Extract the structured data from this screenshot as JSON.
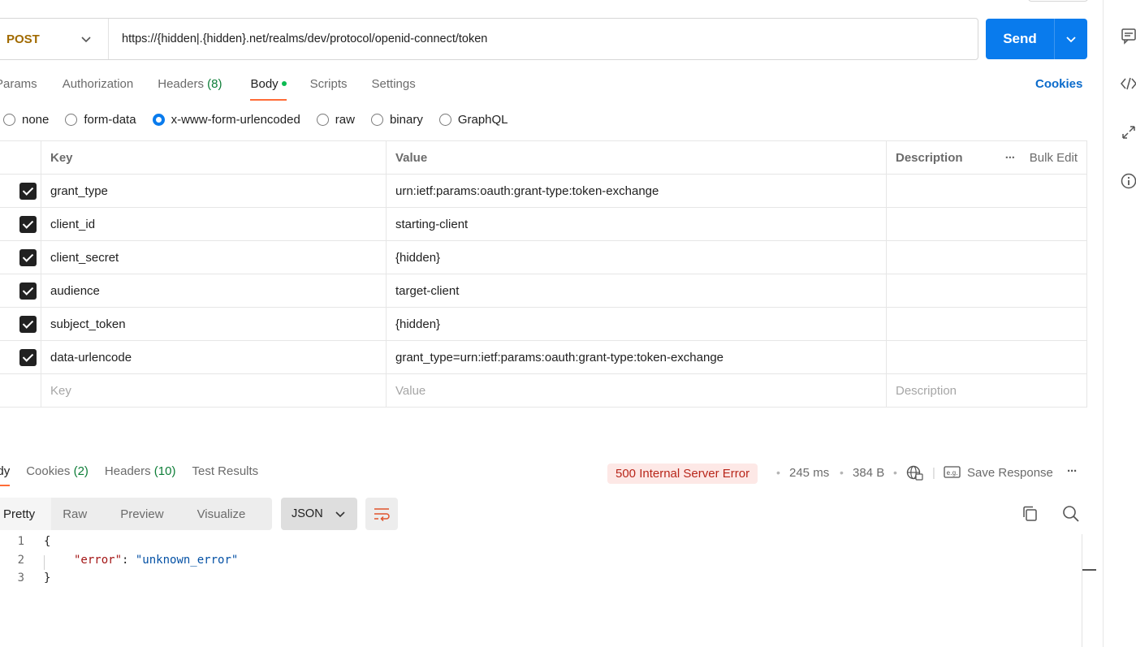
{
  "request": {
    "method": "POST",
    "url": "https://{hidden|.{hidden}.net/realms/dev/protocol/openid-connect/token",
    "send_label": "Send"
  },
  "tabs": [
    {
      "label": "Params",
      "count": ""
    },
    {
      "label": "Authorization",
      "count": ""
    },
    {
      "label": "Headers",
      "count": "(8)"
    },
    {
      "label": "Body",
      "count": ""
    },
    {
      "label": "Scripts",
      "count": ""
    },
    {
      "label": "Settings",
      "count": ""
    }
  ],
  "cookies_label": "Cookies",
  "body_types": [
    "none",
    "form-data",
    "x-www-form-urlencoded",
    "raw",
    "binary",
    "GraphQL"
  ],
  "body_type_selected": "x-www-form-urlencoded",
  "table": {
    "headers": {
      "key": "Key",
      "value": "Value",
      "description": "Description",
      "bulk_edit": "Bulk Edit"
    },
    "rows": [
      {
        "key": "grant_type",
        "value": "urn:ietf:params:oauth:grant-type:token-exchange"
      },
      {
        "key": "client_id",
        "value": "starting-client"
      },
      {
        "key": "client_secret",
        "value": "{hidden}"
      },
      {
        "key": "audience",
        "value": "target-client"
      },
      {
        "key": "subject_token",
        "value": "{hidden}"
      },
      {
        "key": "data-urlencode",
        "value": "grant_type=urn:ietf:params:oauth:grant-type:token-exchange"
      }
    ],
    "placeholders": {
      "key": "Key",
      "value": "Value",
      "description": "Description"
    }
  },
  "response": {
    "tabs": [
      {
        "label": "Body",
        "count": ""
      },
      {
        "label": "Cookies",
        "count": "(2)"
      },
      {
        "label": "Headers",
        "count": "(10)"
      },
      {
        "label": "Test Results",
        "count": ""
      }
    ],
    "status": "500 Internal Server Error",
    "time": "245 ms",
    "size": "384 B",
    "save_response": "Save Response",
    "views": [
      "Pretty",
      "Raw",
      "Preview",
      "Visualize"
    ],
    "format": "JSON",
    "code": {
      "line_numbers": [
        "1",
        "2",
        "3"
      ],
      "open_brace": "{",
      "key": "\"error\"",
      "colon": ": ",
      "value": "\"unknown_error\"",
      "close_brace": "}"
    }
  },
  "colors": {
    "accent": "#097bed",
    "tab_underline": "#ff6c37",
    "method": "#a16a00",
    "error_bg": "#fde8e6",
    "error_text": "#b8261a"
  },
  "icons": [
    "chevron-down-icon",
    "comment-icon",
    "code-icon",
    "related-icon",
    "info-icon",
    "globe-icon",
    "save-icon",
    "more-icon",
    "wrap-icon",
    "copy-icon",
    "search-icon"
  ]
}
